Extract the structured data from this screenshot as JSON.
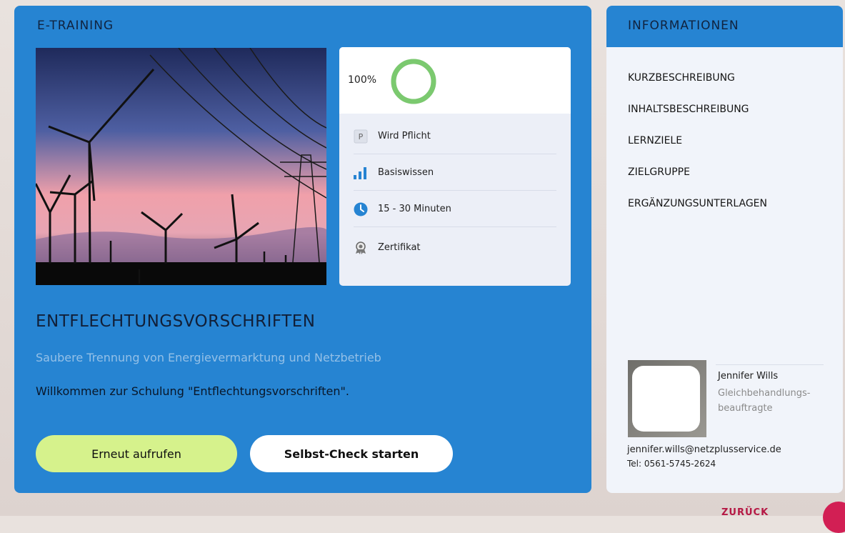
{
  "main": {
    "section_title": "E-TRAINING",
    "progress": {
      "label": "100%",
      "value": 1.0
    },
    "info_rows": [
      {
        "icon": "p-badge-icon",
        "label": "Wird Pflicht"
      },
      {
        "icon": "signal-bars-icon",
        "label": "Basiswissen"
      },
      {
        "icon": "clock-icon",
        "label": "15 - 30 Minuten"
      },
      {
        "icon": "certificate-icon",
        "label": "Zertifikat"
      }
    ],
    "p_badge_letter": "P",
    "course_title": "ENTFLECHTUNGSVORSCHRIFTEN",
    "course_subtitle": "Saubere Trennung von Energievermarktung und Netzbetrieb",
    "welcome_text": "Willkommen zur Schulung \"Entflechtungsvorschriften\".",
    "primary_button": "Erneut aufrufen",
    "secondary_button": "Selbst-Check starten"
  },
  "sidebar": {
    "title": "INFORMATIONEN",
    "links": [
      "KURZBESCHREIBUNG",
      "INHALTSBESCHREIBUNG",
      "LERNZIELE",
      "ZIELGRUPPE",
      "ERGÄNZUNGSUNTERLAGEN"
    ],
    "contact": {
      "name": "Jennifer Wills",
      "role": "Gleichbehandlungs-beauftragte",
      "email": "jennifer.wills@netzplusservice.de",
      "phone": "Tel: 0561-5745-2624"
    }
  },
  "footer": {
    "back_label": "ZURÜCK"
  },
  "colors": {
    "primary_blue": "#2684d2",
    "button_green": "#d6f28c",
    "progress_green": "#7bc96f",
    "accent_red": "#d21f54"
  }
}
